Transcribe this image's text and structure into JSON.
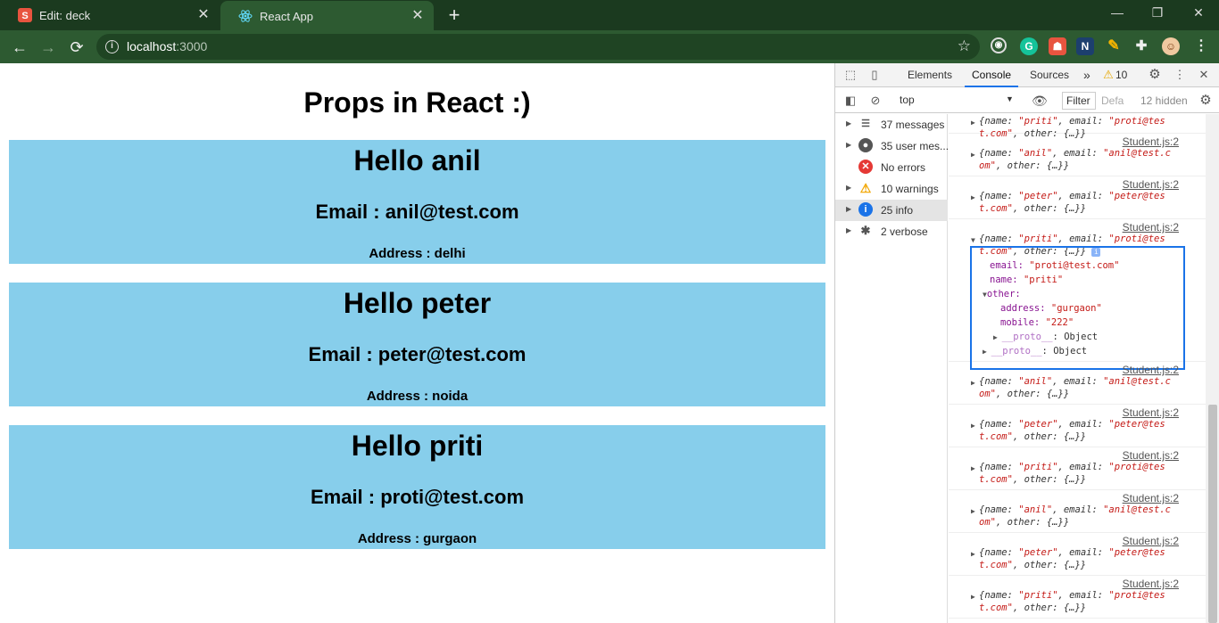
{
  "browser": {
    "tabs": [
      {
        "title": "Edit: deck",
        "favicon": "slides-icon",
        "active": false
      },
      {
        "title": "React App",
        "favicon": "react-icon",
        "active": true
      }
    ],
    "url_host": "localhost",
    "url_port": ":3000"
  },
  "page": {
    "title": "Props in React :)",
    "students": [
      {
        "hello": "Hello anil",
        "email": "Email : anil@test.com",
        "address": "Address : delhi"
      },
      {
        "hello": "Hello peter",
        "email": "Email : peter@test.com",
        "address": "Address : noida"
      },
      {
        "hello": "Hello priti",
        "email": "Email : proti@test.com",
        "address": "Address : gurgaon"
      }
    ],
    "card_color": "#87ceeb"
  },
  "devtools": {
    "tabs": [
      "Elements",
      "Console",
      "Sources"
    ],
    "active_tab": "Console",
    "more": "»",
    "warning_count": "10",
    "context": "top",
    "filter_placeholder": "Filter",
    "levels": "Defa",
    "hidden": "12 hidden",
    "sidebar": [
      {
        "label": "37 messages",
        "icon": "list-icon"
      },
      {
        "label": "35 user mes...",
        "icon": "user-icon"
      },
      {
        "label": "No errors",
        "icon": "error-icon"
      },
      {
        "label": "10 warnings",
        "icon": "warning-icon"
      },
      {
        "label": "25 info",
        "icon": "info-icon"
      },
      {
        "label": "2 verbose",
        "icon": "bug-icon"
      }
    ],
    "source_link": "Student.js:2",
    "top_partial": {
      "l1_a": "{name: ",
      "l1_b": "\"priti\"",
      "l1_c": ", email: ",
      "l1_d": "\"proti@tes",
      "l2_a": "t.com\"",
      "l2_b": ", other: {…}}"
    },
    "logs": [
      {
        "name": "\"anil\"",
        "email_a": "\"anil@test.c",
        "email_b": "om\""
      },
      {
        "name": "\"peter\"",
        "email_a": "\"peter@tes",
        "email_b": "t.com\""
      },
      {
        "name": "\"priti\"",
        "email_a": "\"proti@tes",
        "email_b": "t.com\""
      },
      {
        "name": "\"anil\"",
        "email_a": "\"anil@test.c",
        "email_b": "om\""
      },
      {
        "name": "\"peter\"",
        "email_a": "\"peter@tes",
        "email_b": "t.com\""
      },
      {
        "name": "\"priti\"",
        "email_a": "\"proti@tes",
        "email_b": "t.com\""
      },
      {
        "name": "\"anil\"",
        "email_a": "\"anil@test.c",
        "email_b": "om\""
      },
      {
        "name": "\"peter\"",
        "email_a": "\"peter@tes",
        "email_b": "t.com\""
      },
      {
        "name": "\"priti\"",
        "email_a": "\"proti@tes",
        "email_b": "t.com\""
      }
    ],
    "expanded": {
      "email_key": "email:",
      "email_val": "\"proti@test.com\"",
      "name_key": "name:",
      "name_val": "\"priti\"",
      "other_key": "other:",
      "address_key": "address:",
      "address_val": "\"gurgaon\"",
      "mobile_key": "mobile:",
      "mobile_val": "\"222\"",
      "proto_key": "__proto__",
      "proto_val": ": Object"
    },
    "obj_prefix": "{name: ",
    "obj_email": ", email: ",
    "obj_other": ", other: {…}}"
  }
}
